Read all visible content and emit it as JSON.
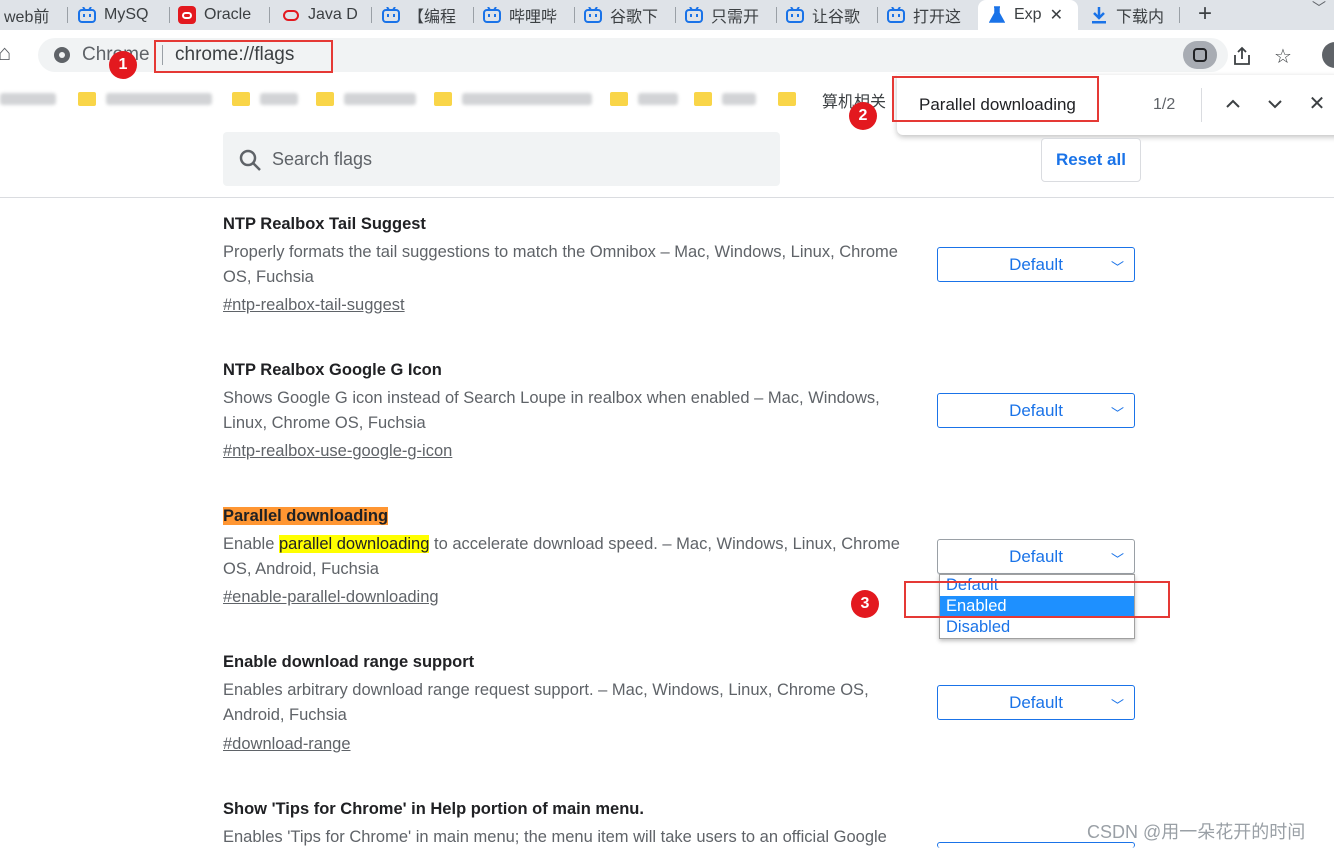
{
  "tabs": [
    {
      "label": "web前",
      "icon": "none"
    },
    {
      "label": "MySQ",
      "icon": "bilibili-icon"
    },
    {
      "label": "Oracle",
      "icon": "oracle-icon"
    },
    {
      "label": "Java D",
      "icon": "oracle-icon"
    },
    {
      "label": "【编程",
      "icon": "bilibili-icon"
    },
    {
      "label": "哔哩哔",
      "icon": "bilibili-icon"
    },
    {
      "label": "谷歌下",
      "icon": "bilibili-icon"
    },
    {
      "label": "只需开",
      "icon": "bilibili-icon"
    },
    {
      "label": "让谷歌",
      "icon": "bilibili-icon"
    },
    {
      "label": "打开这",
      "icon": "bilibili-icon"
    },
    {
      "label": "Exp",
      "icon": "flask-icon",
      "active": true
    },
    {
      "label": "下载内",
      "icon": "download-icon"
    }
  ],
  "toolbar": {
    "site_name": "Chrome",
    "url": "chrome://flags"
  },
  "bookmarks": {
    "visible_text": "算机相关"
  },
  "findbar": {
    "query": "Parallel downloading",
    "count": "1/2"
  },
  "search": {
    "placeholder": "Search flags",
    "reset_label": "Reset all"
  },
  "flags": [
    {
      "title": "NTP Realbox Tail Suggest",
      "desc_1": "Properly formats the tail suggestions to match the Omnibox – Mac, Windows, Linux, Chrome",
      "desc_2": "OS, Fuchsia",
      "link": "#ntp-realbox-tail-suggest",
      "value": "Default"
    },
    {
      "title": "NTP Realbox Google G Icon",
      "desc_1": "Shows Google G icon instead of Search Loupe in realbox when enabled – Mac, Windows,",
      "desc_2": "Linux, Chrome OS, Fuchsia",
      "link": "#ntp-realbox-use-google-g-icon",
      "value": "Default"
    },
    {
      "title": "Parallel downloading",
      "desc_prefix": "Enable ",
      "desc_highlight": "parallel downloading",
      "desc_suffix": " to accelerate download speed. – Mac, Windows, Linux, Chrome",
      "desc_2": "OS, Android, Fuchsia",
      "link": "#enable-parallel-downloading",
      "value": "Default",
      "options": [
        "Default",
        "Enabled",
        "Disabled"
      ],
      "highlighted_option": "Enabled"
    },
    {
      "title": "Enable download range support",
      "desc_1": "Enables arbitrary download range request support. – Mac, Windows, Linux, Chrome OS,",
      "desc_2": "Android, Fuchsia",
      "link": "#download-range",
      "value": "Default"
    },
    {
      "title": "Show 'Tips for Chrome' in Help portion of main menu.",
      "desc_1": "Enables 'Tips for Chrome' in main menu; the menu item will take users to an official Google"
    }
  ],
  "annotations": [
    "1",
    "2",
    "3"
  ],
  "watermark": "CSDN @用一朵花开的时间",
  "colors": {
    "accent": "#1a73e8",
    "annotation_red": "#e3191f",
    "find_current_match": "#ff9632",
    "find_match": "#ffff00",
    "selected_option": "#1e90ff"
  }
}
